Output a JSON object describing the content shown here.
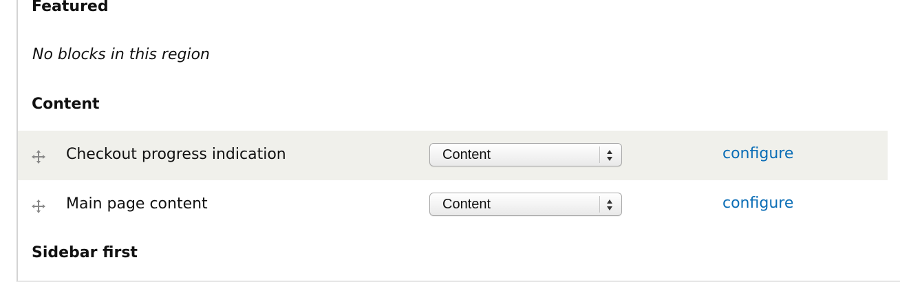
{
  "regions": [
    {
      "title": "Featured",
      "empty_message": "No blocks in this region"
    },
    {
      "title": "Content"
    },
    {
      "title": "Sidebar first"
    }
  ],
  "blocks": [
    {
      "label": "Checkout progress indication",
      "region_value": "Content",
      "action": "configure"
    },
    {
      "label": "Main page content",
      "region_value": "Content",
      "action": "configure"
    }
  ],
  "colors": {
    "link": "#0a6db6",
    "highlight_row": "#f0f0eb",
    "border": "#d3d3d3"
  },
  "icons": {
    "drag": "move-arrows-icon",
    "select": "up-down-arrows-icon"
  }
}
